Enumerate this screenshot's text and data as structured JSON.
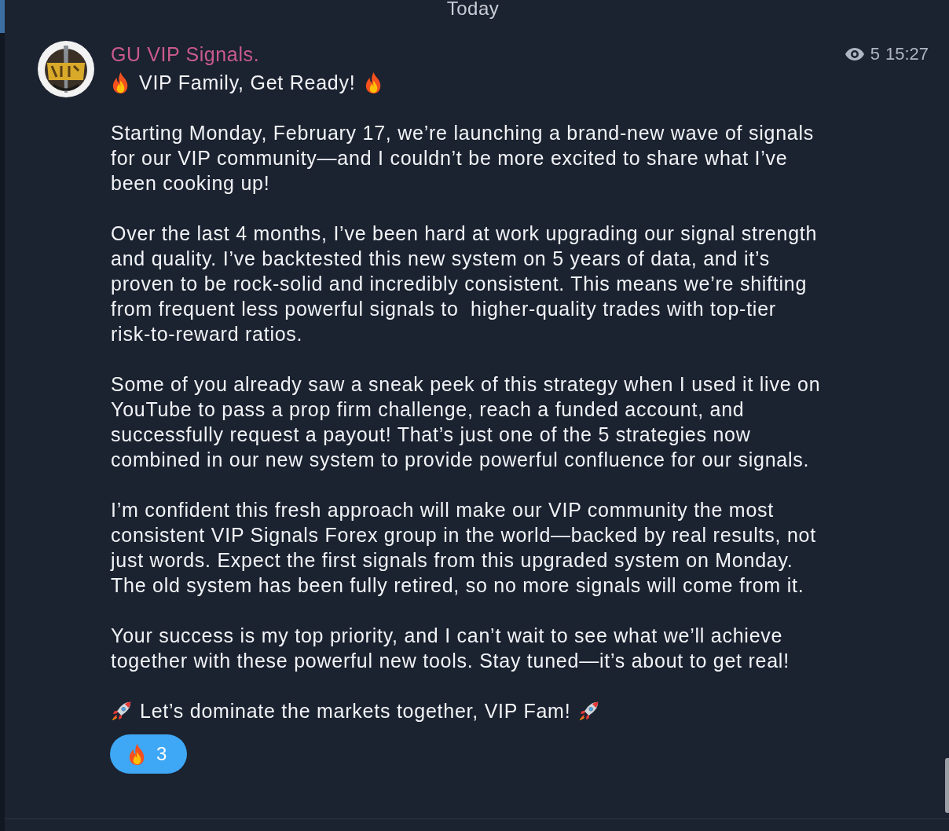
{
  "date_header": "Today",
  "message": {
    "sender": "GU VIP Signals.",
    "views": "5",
    "time": "15:27",
    "heading": "VIP Family, Get Ready!",
    "paragraphs": [
      [
        "Starting Monday, February 17, we’re launching a brand-new wave of signals",
        "for our VIP community—and I couldn’t be more excited to share what I’ve",
        "been cooking up!"
      ],
      [
        "Over the last 4 months, I’ve been hard at work upgrading our signal strength",
        "and quality. I’ve backtested this new system on 5 years of data, and it’s",
        "proven to be rock-solid and incredibly consistent. This means we’re shifting",
        "from frequent less powerful signals to  higher-quality trades with top-tier",
        "risk-to-reward ratios."
      ],
      [
        "Some of you already saw a sneak peek of this strategy when I used it live on",
        "YouTube to pass a prop firm challenge, reach a funded account, and",
        "successfully request a payout! That’s just one of the 5 strategies now",
        "combined in our new system to provide powerful confluence for our signals."
      ],
      [
        "I’m confident this fresh approach will make our VIP community the most",
        "consistent VIP Signals Forex group in the world—backed by real results, not",
        "just words. Expect the first signals from this upgraded system on Monday.",
        "The old system has been fully retired, so no more signals will come from it."
      ],
      [
        "Your success is my top priority, and I can’t wait to see what we’ll achieve",
        "together with these powerful new tools. Stay tuned—it’s about to get real!"
      ]
    ],
    "closing": "Let’s dominate the markets together, VIP Fam!",
    "reactions": [
      {
        "count": "3",
        "selected": true
      }
    ]
  }
}
